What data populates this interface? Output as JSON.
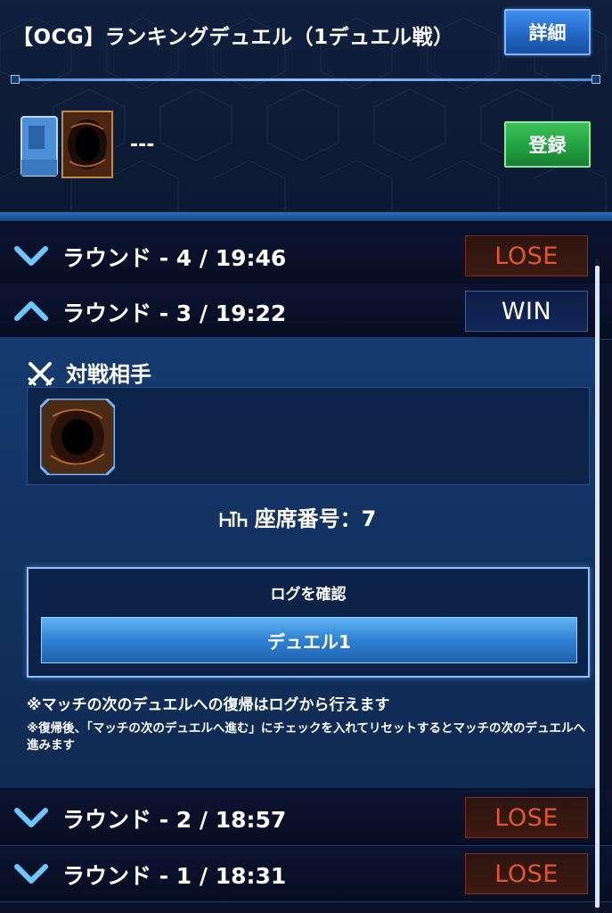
{
  "header": {
    "title": "【OCG】ランキングデュエル（1デュエル戦）",
    "detail_button": "詳細",
    "deck_name": "---",
    "register_button": "登録"
  },
  "rounds": [
    {
      "label": "ラウンド - 4 / 19:46",
      "result": "LOSE",
      "expanded": false
    },
    {
      "label": "ラウンド - 3 / 19:22",
      "result": "WIN",
      "expanded": true
    },
    {
      "label": "ラウンド - 2 / 18:57",
      "result": "LOSE",
      "expanded": false
    },
    {
      "label": "ラウンド - 1 / 18:31",
      "result": "LOSE",
      "expanded": false
    }
  ],
  "expanded": {
    "opponent_title": "対戦相手",
    "seat_label": "座席番号：7",
    "log_title": "ログを確認",
    "duel_button": "デュエル1",
    "note1": "※マッチの次のデュエルへの復帰はログから行えます",
    "note2": "※復帰後、「マッチの次のデュエルへ進む」にチェックを入れてリセットするとマッチの次のデュエルへ進みます"
  },
  "colors": {
    "lose": "#e0562e",
    "win": "#ffffff",
    "detail_button": "#2466c6",
    "register_button": "#23a041",
    "panel": "#163a70"
  },
  "icons": {
    "chevron_down": "chevron-down-icon",
    "chevron_up": "chevron-up-icon",
    "opponent": "crossed-swords-icon",
    "seat": "seat-icon",
    "deck": "deck-box-icon",
    "card_back": "card-back-icon"
  }
}
